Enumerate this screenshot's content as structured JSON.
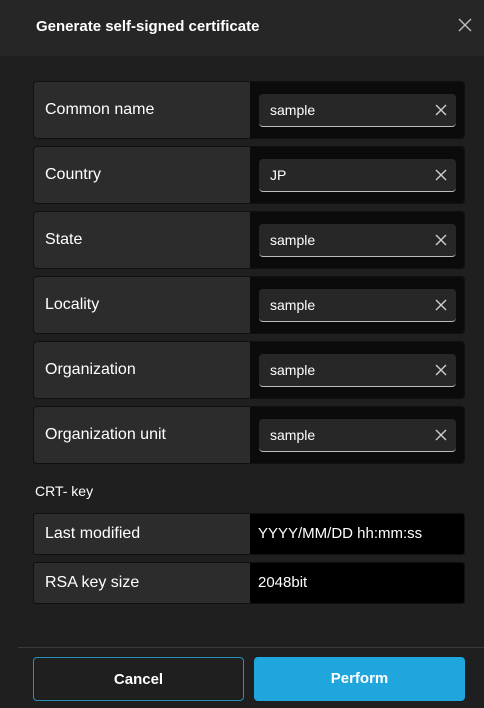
{
  "dialog": {
    "title": "Generate self-signed certificate",
    "close_icon": "close-icon"
  },
  "fields": [
    {
      "label": "Common name",
      "value": "sample"
    },
    {
      "label": "Country",
      "value": "JP"
    },
    {
      "label": "State",
      "value": "sample"
    },
    {
      "label": "Locality",
      "value": "sample"
    },
    {
      "label": "Organization",
      "value": "sample"
    },
    {
      "label": "Organization unit",
      "value": "sample"
    }
  ],
  "crt_key": {
    "section_title": "CRT- key",
    "last_modified": {
      "label": "Last modified",
      "value": "YYYY/MM/DD hh:mm:ss"
    },
    "rsa_key_size": {
      "label": "RSA key size",
      "value": "2048bit"
    }
  },
  "footer": {
    "cancel_label": "Cancel",
    "perform_label": "Perform"
  },
  "colors": {
    "accent": "#1fa6dd",
    "background": "#1f1f1f",
    "title_bar": "#262626"
  }
}
